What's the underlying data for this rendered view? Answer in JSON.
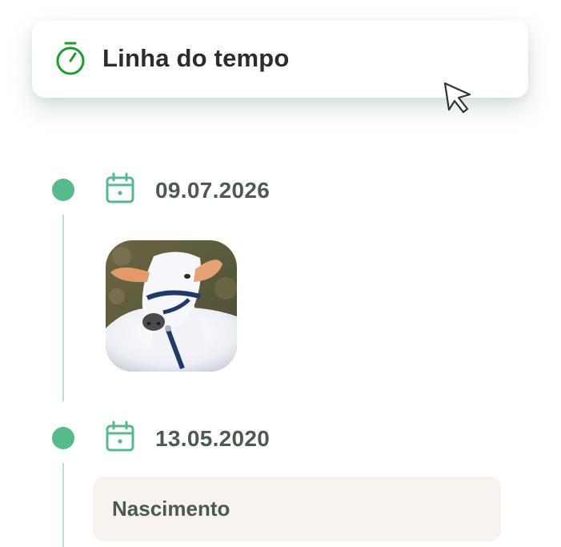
{
  "header": {
    "title": "Linha do tempo",
    "icon": "stopwatch-icon",
    "accent_color": "#1e9a2f"
  },
  "timeline": {
    "dot_color": "#56ba8c",
    "line_color": "#b9ddd0",
    "entries": [
      {
        "date": "09.07.2026",
        "icon": "calendar-icon",
        "content_type": "photo"
      },
      {
        "date": "13.05.2020",
        "icon": "calendar-icon",
        "content_type": "event",
        "event_label": "Nascimento"
      }
    ]
  }
}
